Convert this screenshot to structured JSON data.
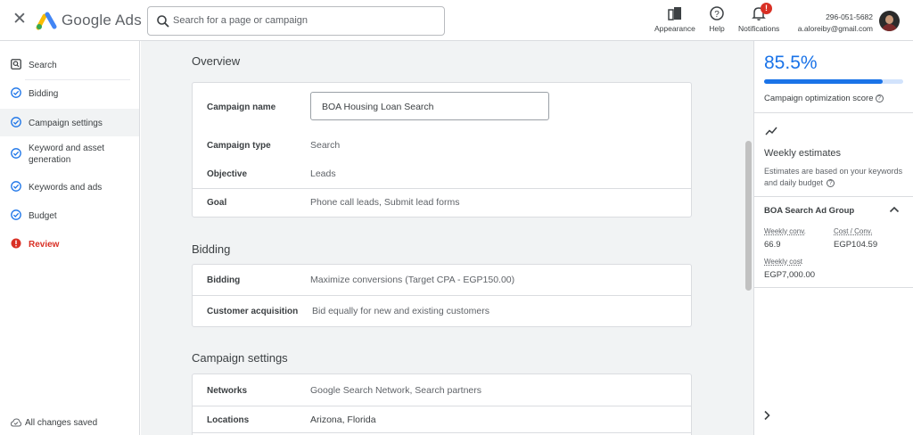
{
  "header": {
    "brand": "Google Ads",
    "search_placeholder": "Search for a page or campaign",
    "appearance_label": "Appearance",
    "help_label": "Help",
    "notifications_label": "Notifications",
    "notification_badge": "!",
    "account_id": "296-051-5682",
    "account_email": "a.aloreiby@gmail.com"
  },
  "sidebar": {
    "items": [
      {
        "label": "Search",
        "icon": "search-box-icon",
        "status": "none"
      },
      {
        "label": "Bidding",
        "icon": "check-circle-icon",
        "status": "done"
      },
      {
        "label": "Campaign settings",
        "icon": "check-circle-icon",
        "status": "done"
      },
      {
        "label": "Keyword and asset generation",
        "icon": "check-circle-icon",
        "status": "done"
      },
      {
        "label": "Keywords and ads",
        "icon": "check-circle-icon",
        "status": "done"
      },
      {
        "label": "Budget",
        "icon": "check-circle-icon",
        "status": "done"
      },
      {
        "label": "Review",
        "icon": "error-icon",
        "status": "error"
      }
    ],
    "saved_status": "All changes saved"
  },
  "overview": {
    "title": "Overview",
    "campaign_name_label": "Campaign name",
    "campaign_name_value": "BOA Housing Loan Search",
    "campaign_type_label": "Campaign type",
    "campaign_type_value": "Search",
    "objective_label": "Objective",
    "objective_value": "Leads",
    "goal_label": "Goal",
    "goal_value": "Phone call leads, Submit lead forms"
  },
  "bidding": {
    "title": "Bidding",
    "bidding_label": "Bidding",
    "bidding_value": "Maximize conversions (Target CPA - EGP150.00)",
    "acquisition_label": "Customer acquisition",
    "acquisition_value": "Bid equally for new and existing customers"
  },
  "campaign_settings": {
    "title": "Campaign settings",
    "networks_label": "Networks",
    "networks_value": "Google Search Network, Search partners",
    "locations_label": "Locations",
    "locations_value": "Arizona, Florida"
  },
  "panel": {
    "score": "85.5%",
    "score_fraction": 0.855,
    "score_label": "Campaign optimization score",
    "weekly_title": "Weekly estimates",
    "weekly_desc": "Estimates are based on your keywords and daily budget",
    "group_name": "BOA Search Ad Group",
    "conv_label": "Weekly conv.",
    "conv_value": "66.9",
    "cost_conv_label": "Cost / Conv.",
    "cost_conv_value": "EGP104.59",
    "cost_label": "Weekly cost",
    "cost_value": "EGP7,000.00"
  },
  "colors": {
    "accent": "#1a73e8",
    "error": "#d93025",
    "bar_track": "#d2e3fc"
  }
}
